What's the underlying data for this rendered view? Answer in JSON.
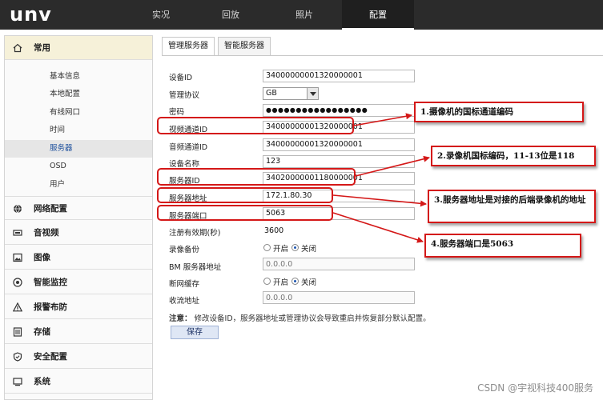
{
  "brand": "unv",
  "nav": {
    "tabs": [
      {
        "label": "实况"
      },
      {
        "label": "回放"
      },
      {
        "label": "照片"
      },
      {
        "label": "配置"
      }
    ],
    "active_index": 3
  },
  "sidebar": {
    "groups": [
      {
        "label": "常用",
        "icon": "home-icon",
        "open": true
      },
      {
        "label": "网络配置",
        "icon": "globe-icon"
      },
      {
        "label": "音视频",
        "icon": "video-icon"
      },
      {
        "label": "图像",
        "icon": "image-icon"
      },
      {
        "label": "智能监控",
        "icon": "eye-icon"
      },
      {
        "label": "报警布防",
        "icon": "warning-icon"
      },
      {
        "label": "存储",
        "icon": "storage-icon"
      },
      {
        "label": "安全配置",
        "icon": "shield-icon"
      },
      {
        "label": "系统",
        "icon": "system-icon"
      }
    ],
    "items": [
      {
        "label": "基本信息"
      },
      {
        "label": "本地配置"
      },
      {
        "label": "有线网口"
      },
      {
        "label": "时间"
      },
      {
        "label": "服务器",
        "active": true
      },
      {
        "label": "OSD"
      },
      {
        "label": "用户"
      }
    ]
  },
  "subtabs": [
    {
      "label": "管理服务器",
      "active": true
    },
    {
      "label": "智能服务器"
    }
  ],
  "form": {
    "device_id": {
      "label": "设备ID",
      "value": "34000000001320000001"
    },
    "protocol": {
      "label": "管理协议",
      "value": "GB"
    },
    "password": {
      "label": "密码",
      "value": "●●●●●●●●●●●●●●●●●"
    },
    "video_channel_id": {
      "label": "视频通道ID",
      "value": "34000000001320000001"
    },
    "audio_channel_id": {
      "label": "音频通道ID",
      "value": "34000000001320000001"
    },
    "device_name": {
      "label": "设备名称",
      "value": "123"
    },
    "server_id": {
      "label": "服务器ID",
      "value": "34020000001180000001"
    },
    "server_address": {
      "label": "服务器地址",
      "value": "172.1.80.30"
    },
    "server_port": {
      "label": "服务器端口",
      "value": "5063"
    },
    "register_period": {
      "label": "注册有效期(秒)",
      "value": "3600"
    },
    "recording_backup": {
      "label": "录像备份",
      "on": "开启",
      "off": "关闭",
      "selected": "off"
    },
    "bm_server_address": {
      "label": "BM 服务器地址",
      "placeholder": "0.0.0.0"
    },
    "network_cache": {
      "label": "断网缓存",
      "on": "开启",
      "off": "关闭",
      "selected": "off"
    },
    "collect_address": {
      "label": "收流地址",
      "placeholder": "0.0.0.0"
    }
  },
  "note": {
    "prefix": "注意：",
    "text": "修改设备ID，服务器地址或管理协议会导致重启并恢复部分默认配置。"
  },
  "save_label": "保存",
  "annotations": [
    {
      "text": "1.摄像机的国标通道编码"
    },
    {
      "text": "2.录像机国标编码，11-13位是118"
    },
    {
      "text": "3.服务器地址是对接的后端录像机的地址"
    },
    {
      "text": "4.服务器端口是5063"
    }
  ],
  "annotation_color": "#d41818",
  "watermark": "CSDN @宇视科技400服务"
}
